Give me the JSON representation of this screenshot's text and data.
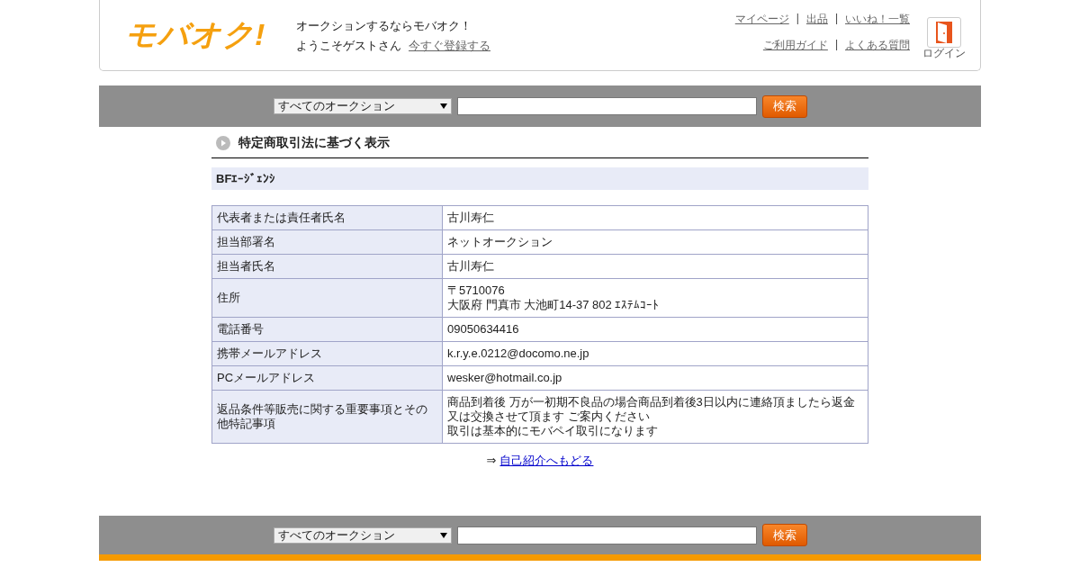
{
  "header": {
    "logo": "モバオク!",
    "tagline": "オークションするならモバオク！",
    "welcome": "ようこそゲストさん",
    "register_link": "今すぐ登録する",
    "nav_row_1": [
      "マイページ",
      "出品",
      "いいね！一覧"
    ],
    "nav_row_2": [
      "ご利用ガイド",
      "よくある質問"
    ],
    "separator": "|",
    "login_label": "ログイン"
  },
  "search_top": {
    "category": "すべてのオークション",
    "button": "検索"
  },
  "section_title": "特定商取引法に基づく表示",
  "shop_name": "BFｴｰｼﾞｪﾝｼ",
  "table": {
    "rows": [
      {
        "label": "代表者または責任者氏名",
        "value": [
          "古川寿仁"
        ]
      },
      {
        "label": "担当部署名",
        "value": [
          "ネットオークション"
        ]
      },
      {
        "label": "担当者氏名",
        "value": [
          "古川寿仁"
        ]
      },
      {
        "label": "住所",
        "value": [
          "〒5710076",
          "大阪府 門真市 大池町14-37 802 ｴｽﾃﾑｺｰﾄ"
        ]
      },
      {
        "label": "電話番号",
        "value": [
          "09050634416"
        ]
      },
      {
        "label": "携帯メールアドレス",
        "value": [
          "k.r.y.e.0212@docomo.ne.jp"
        ]
      },
      {
        "label": "PCメールアドレス",
        "value": [
          "wesker@hotmail.co.jp"
        ]
      },
      {
        "label": "返品条件等販売に関する重要事項とその他特記事項",
        "value": [
          "商品到着後 万が一初期不良品の場合商品到着後3日以内に連絡頂ましたら返金又は交換させて頂ます ご案内ください",
          "取引は基本的にモバペイ取引になります"
        ]
      }
    ]
  },
  "back": {
    "arrow": "⇒",
    "link": "自己紹介へもどる"
  },
  "search_bottom": {
    "category": "すべてのオークション",
    "button": "検索"
  }
}
